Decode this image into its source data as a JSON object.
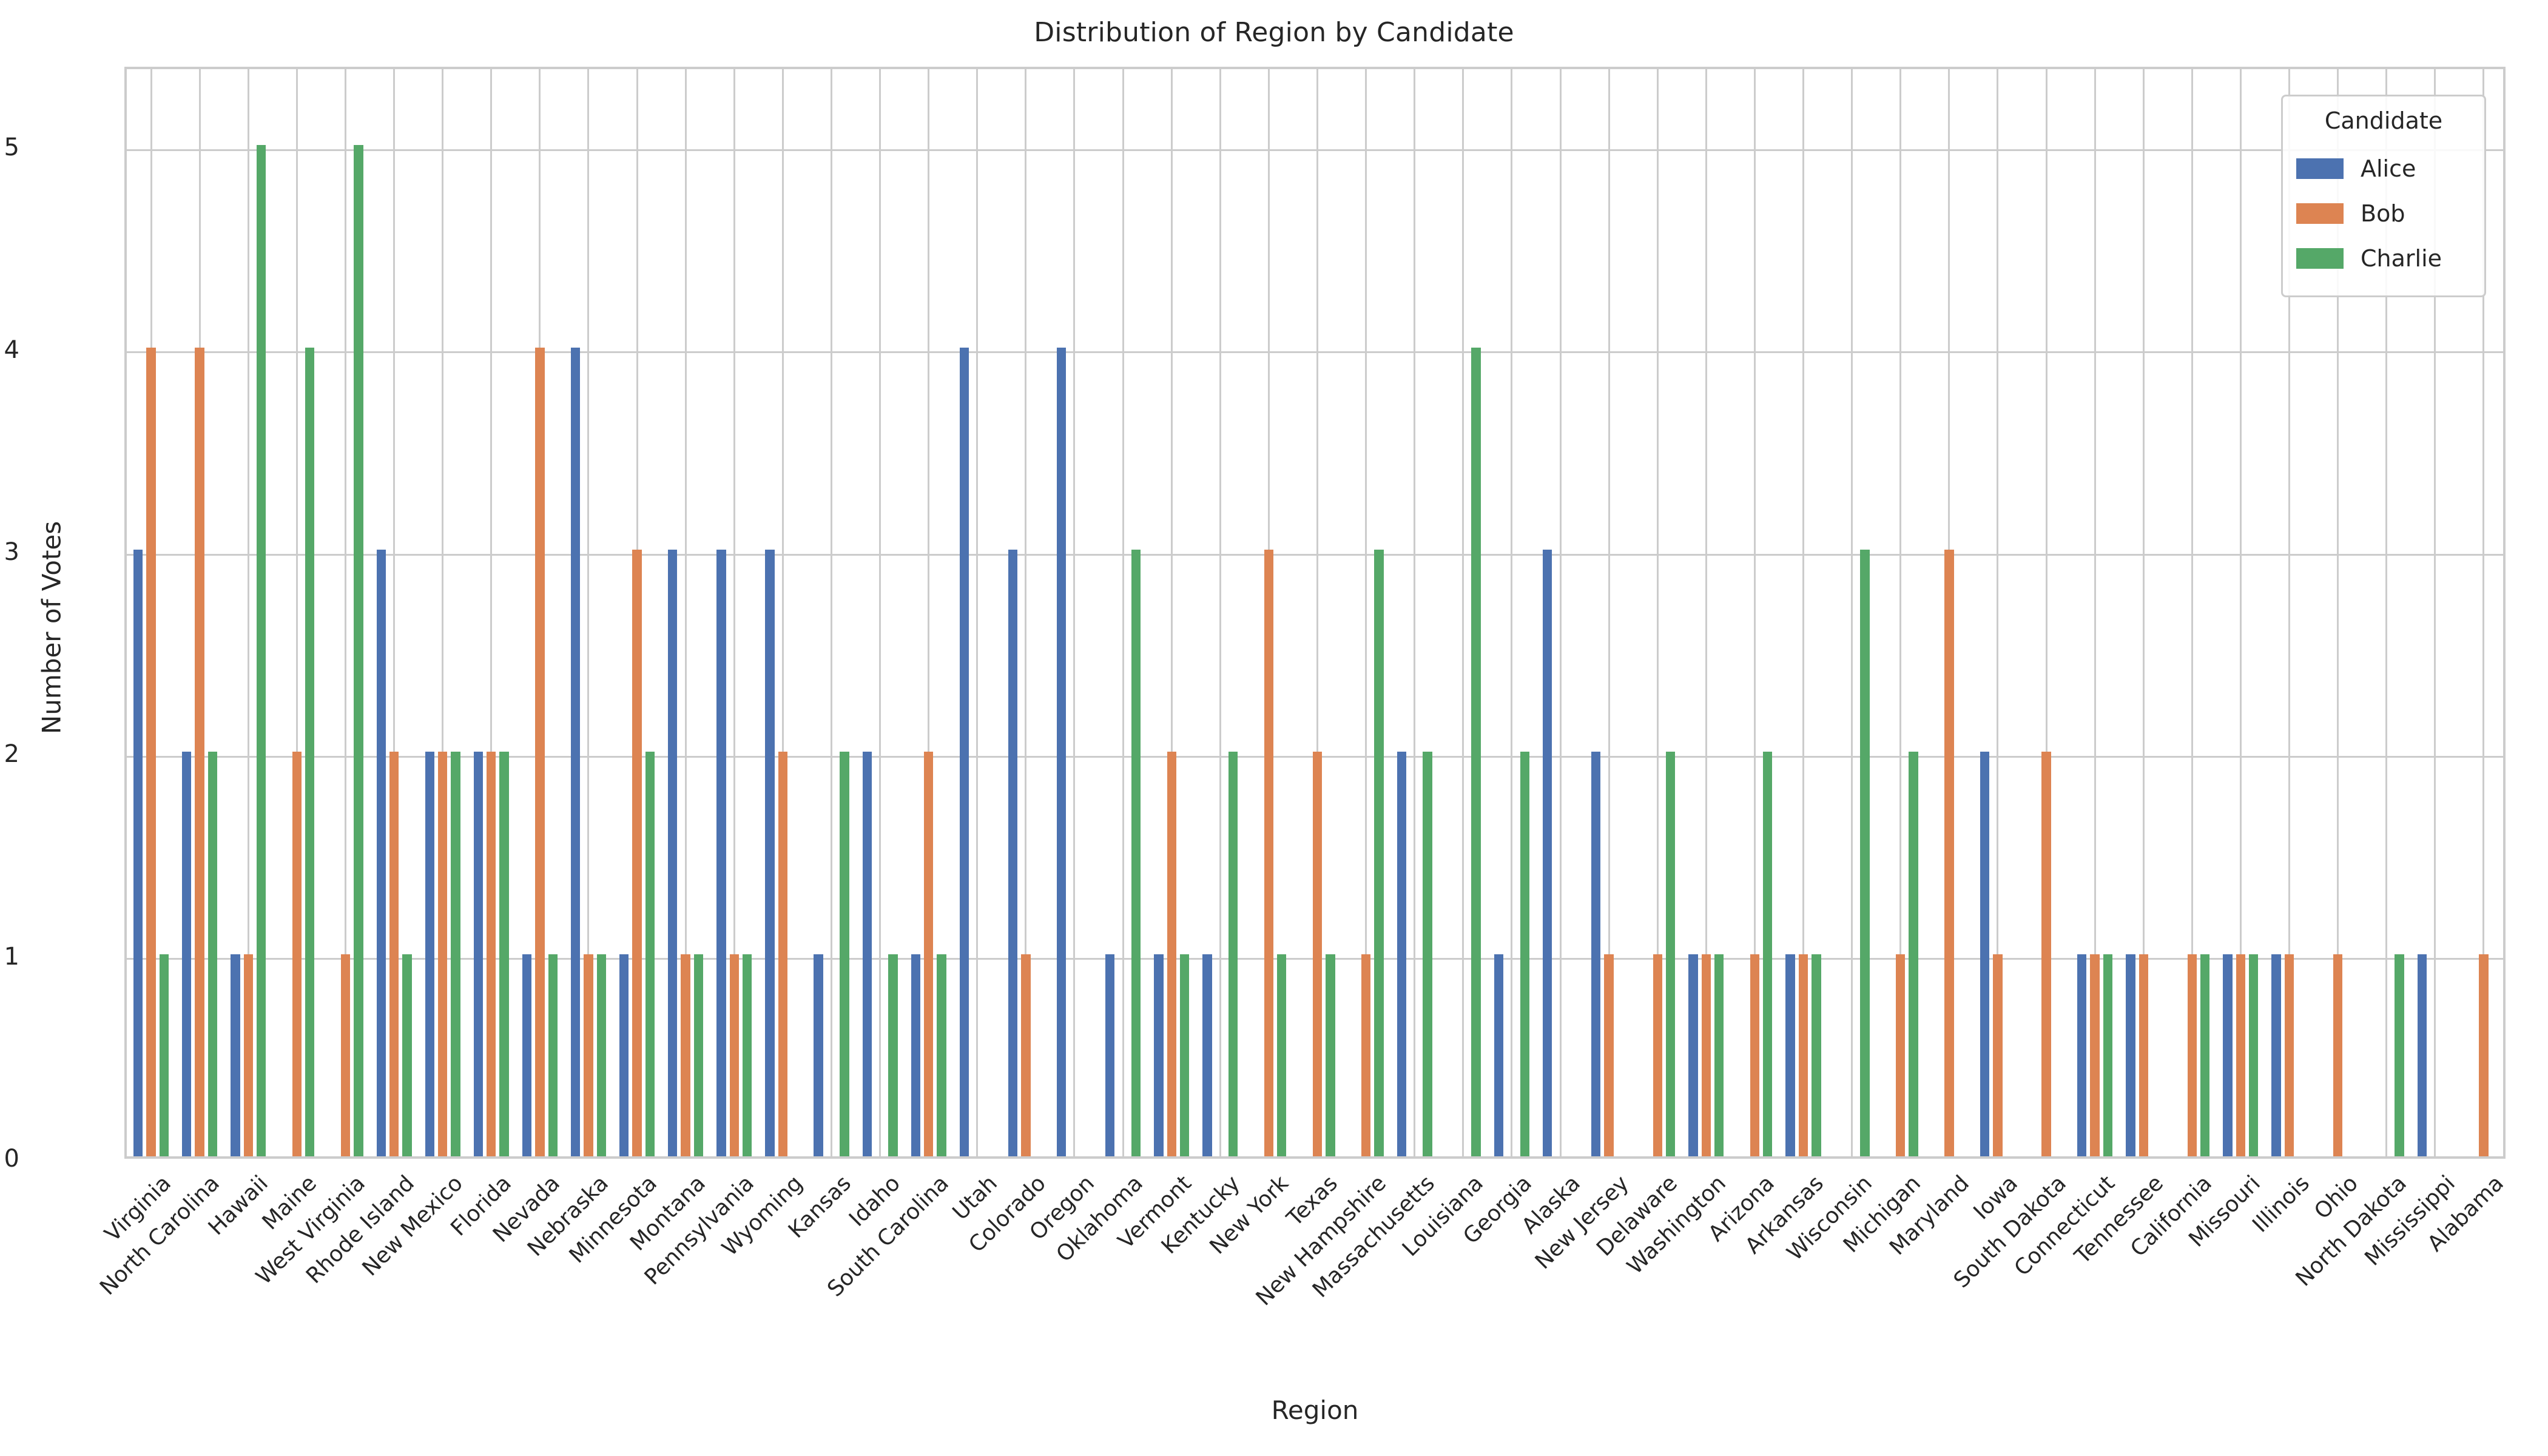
{
  "chart_data": {
    "type": "bar",
    "title": "Distribution of Region by Candidate",
    "xlabel": "Region",
    "ylabel": "Number of Votes",
    "ylim": [
      0,
      5.4
    ],
    "yticks": [
      0,
      1,
      2,
      3,
      4,
      5
    ],
    "ytick_labels": [
      "0",
      "1",
      "2",
      "3",
      "4",
      "5"
    ],
    "grid": true,
    "legend_title": "Candidate",
    "legend_position": "upper right",
    "colors": {
      "Alice": "#4c72b0",
      "Bob": "#dd8452",
      "Charlie": "#55a868"
    },
    "categories": [
      "Virginia",
      "North Carolina",
      "Hawaii",
      "Maine",
      "West Virginia",
      "Rhode Island",
      "New Mexico",
      "Florida",
      "Nevada",
      "Nebraska",
      "Minnesota",
      "Montana",
      "Pennsylvania",
      "Wyoming",
      "Kansas",
      "Idaho",
      "South Carolina",
      "Utah",
      "Colorado",
      "Oregon",
      "Oklahoma",
      "Vermont",
      "Kentucky",
      "New York",
      "Texas",
      "New Hampshire",
      "Massachusetts",
      "Louisiana",
      "Georgia",
      "Alaska",
      "New Jersey",
      "Delaware",
      "Washington",
      "Arizona",
      "Arkansas",
      "Wisconsin",
      "Michigan",
      "Maryland",
      "Iowa",
      "South Dakota",
      "Connecticut",
      "Tennessee",
      "California",
      "Missouri",
      "Illinois",
      "Ohio",
      "North Dakota",
      "Mississippi",
      "Alabama"
    ],
    "series": [
      {
        "name": "Alice",
        "color": "#4c72b0",
        "values": [
          3,
          2,
          1,
          0,
          0,
          3,
          2,
          2,
          1,
          4,
          1,
          3,
          3,
          3,
          1,
          2,
          1,
          4,
          3,
          4,
          1,
          1,
          1,
          0,
          0,
          0,
          2,
          0,
          1,
          3,
          2,
          0,
          1,
          0,
          1,
          0,
          0,
          0,
          2,
          0,
          1,
          1,
          0,
          1,
          1,
          0,
          0,
          1,
          0
        ]
      },
      {
        "name": "Bob",
        "color": "#dd8452",
        "values": [
          4,
          4,
          1,
          2,
          1,
          2,
          2,
          2,
          4,
          1,
          3,
          1,
          1,
          2,
          0,
          0,
          2,
          0,
          1,
          0,
          0,
          2,
          0,
          3,
          2,
          1,
          0,
          0,
          0,
          0,
          1,
          1,
          1,
          1,
          1,
          0,
          1,
          3,
          1,
          2,
          1,
          1,
          1,
          1,
          1,
          1,
          0,
          0,
          1
        ]
      },
      {
        "name": "Charlie",
        "color": "#55a868",
        "values": [
          1,
          2,
          5,
          4,
          5,
          1,
          2,
          2,
          1,
          1,
          2,
          1,
          1,
          0,
          2,
          1,
          1,
          0,
          0,
          0,
          3,
          1,
          2,
          1,
          1,
          3,
          2,
          4,
          2,
          0,
          0,
          2,
          1,
          2,
          1,
          3,
          2,
          0,
          0,
          0,
          1,
          0,
          1,
          1,
          0,
          0,
          1,
          0,
          0
        ]
      }
    ]
  }
}
